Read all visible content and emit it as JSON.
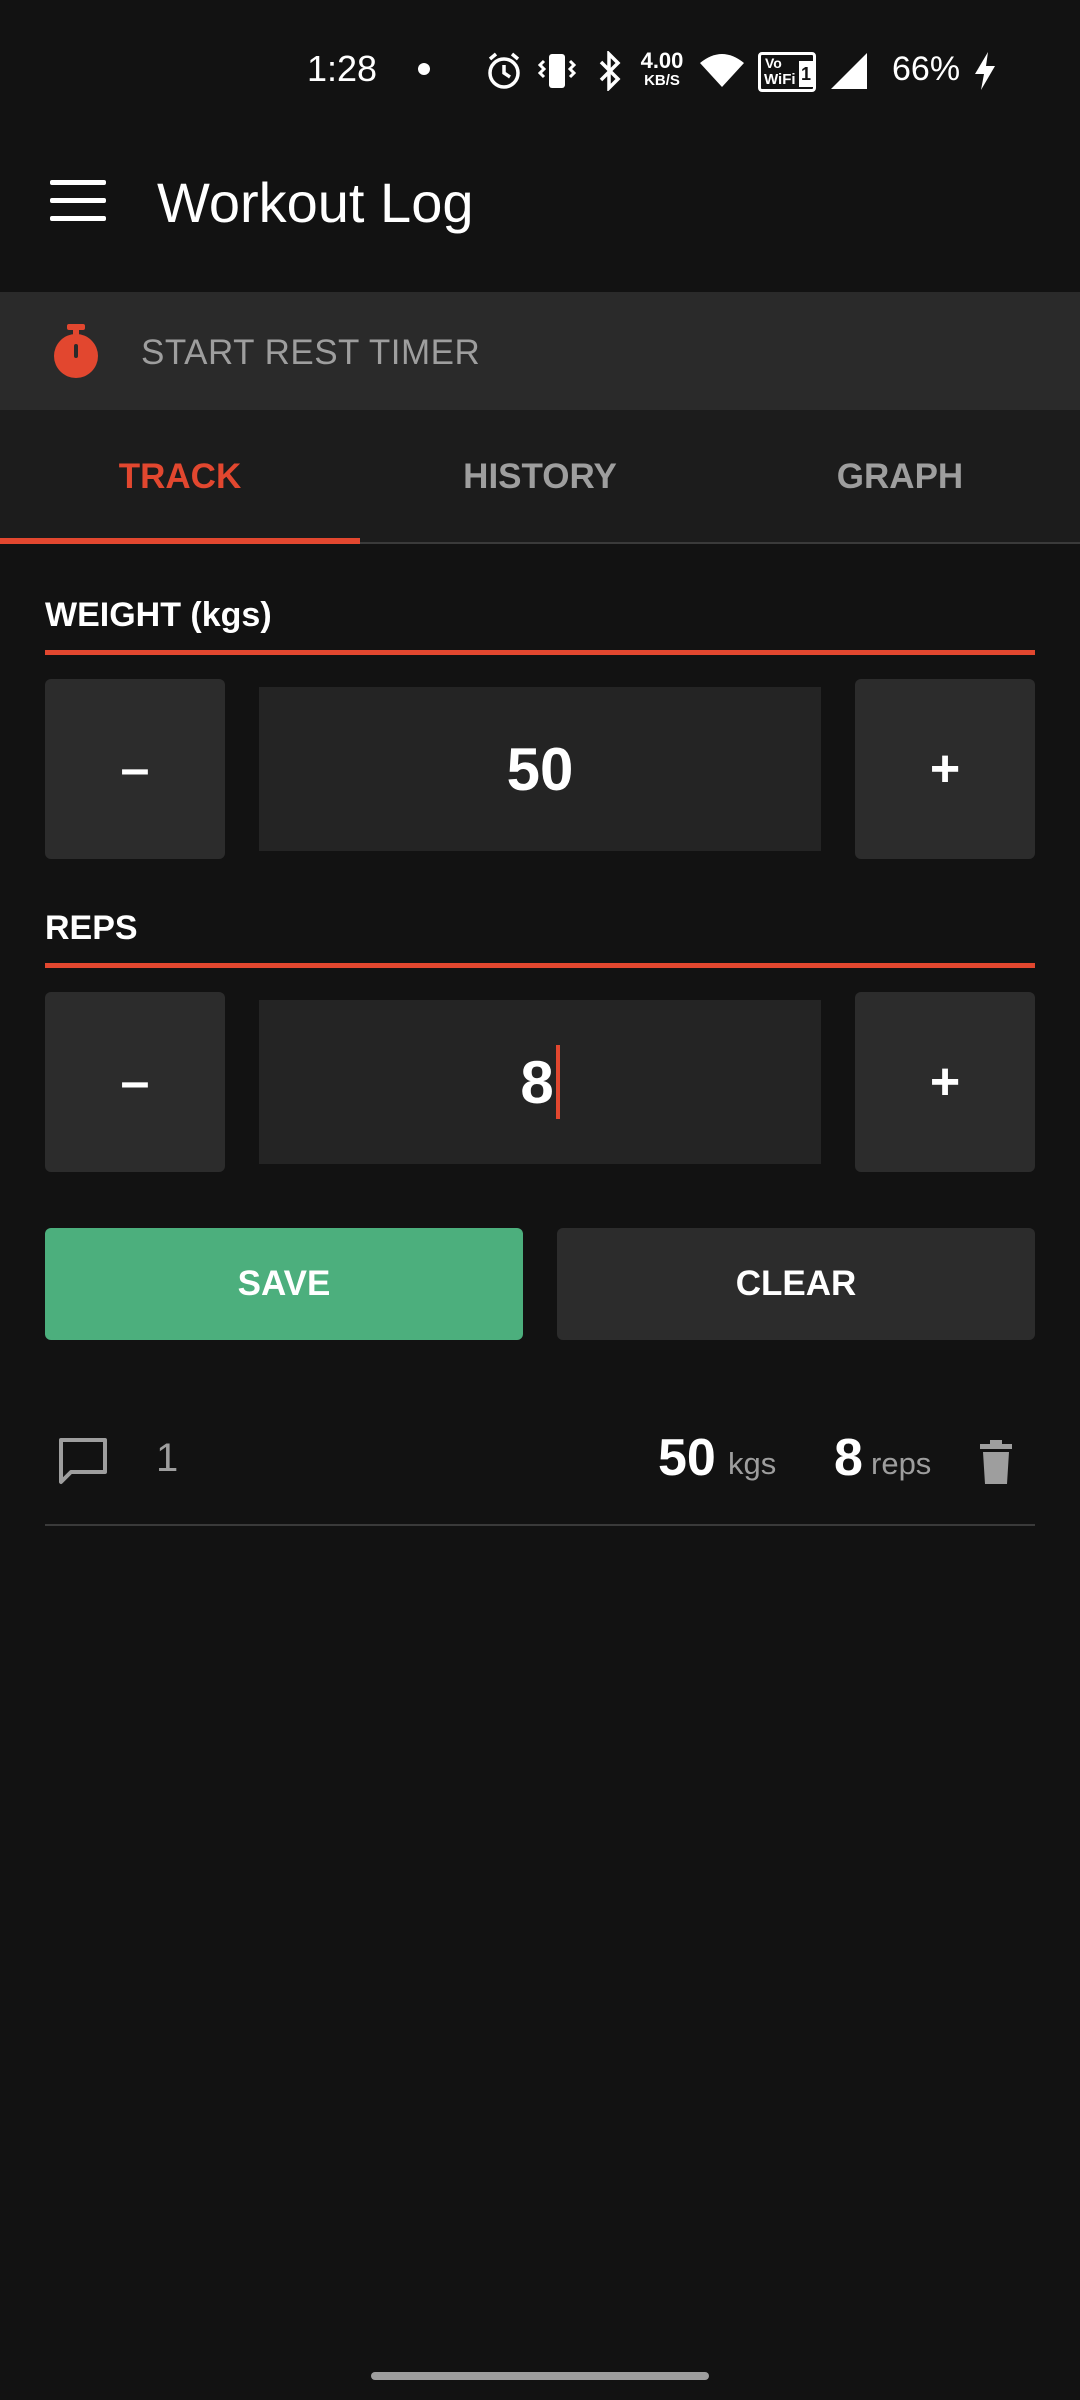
{
  "status_bar": {
    "time": "1:28",
    "data_speed": "4.00",
    "data_speed_unit": "KB/S",
    "volte_label_top": "Vo",
    "volte_label_bottom": "WiFi",
    "volte_number": "1",
    "battery": "66%",
    "icons": [
      "notification-dot",
      "alarm-icon",
      "vibrate-icon",
      "bluetooth-icon",
      "data-speed",
      "wifi-icon",
      "vowifi-icon",
      "signal-icon",
      "battery-charging-icon"
    ]
  },
  "app_bar": {
    "title": "Workout Log",
    "menu_icon": "hamburger-menu-icon"
  },
  "rest_timer": {
    "label": "START REST TIMER",
    "icon": "stopwatch-icon"
  },
  "tabs": [
    {
      "label": "TRACK",
      "active": true
    },
    {
      "label": "HISTORY",
      "active": false
    },
    {
      "label": "GRAPH",
      "active": false
    }
  ],
  "weight": {
    "label": "WEIGHT (kgs)",
    "value": "50",
    "decrement_label": "–",
    "increment_label": "+"
  },
  "reps": {
    "label": "REPS",
    "value": "8",
    "decrement_label": "–",
    "increment_label": "+"
  },
  "actions": {
    "save_label": "SAVE",
    "clear_label": "CLEAR"
  },
  "log": {
    "rows": [
      {
        "index": "1",
        "weight": "50",
        "weight_unit": "kgs",
        "reps": "8",
        "reps_unit": "reps"
      }
    ]
  },
  "colors": {
    "accent": "#e2472f",
    "save": "#4caf7d",
    "background": "#121212",
    "surface": "#2c2c2c"
  }
}
